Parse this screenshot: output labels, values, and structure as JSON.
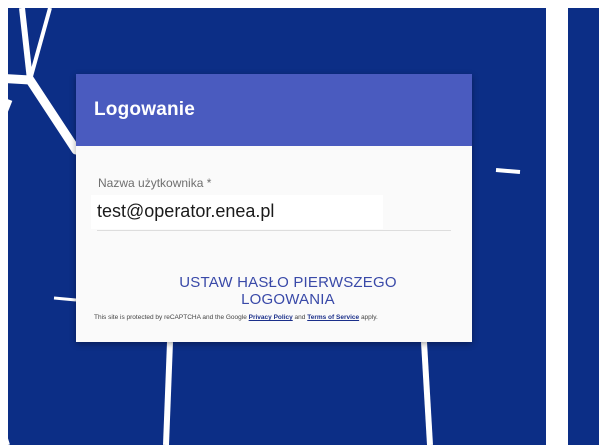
{
  "colors": {
    "background_blue": "#0c2e86",
    "header_blue": "#4a5bbf",
    "button_text": "#3949a8",
    "card_background": "#fafafa"
  },
  "login": {
    "title": "Logowanie",
    "username_label": "Nazwa użytkownika *",
    "username_value": "test@operator.enea.pl",
    "set_password_button": "USTAW HASŁO PIERWSZEGO LOGOWANIA"
  },
  "recaptcha": {
    "prefix": "This site is protected by reCAPTCHA and the Google",
    "privacy_policy": "Privacy Policy",
    "and": "and",
    "terms_of_service": "Terms of Service",
    "suffix": "apply."
  }
}
